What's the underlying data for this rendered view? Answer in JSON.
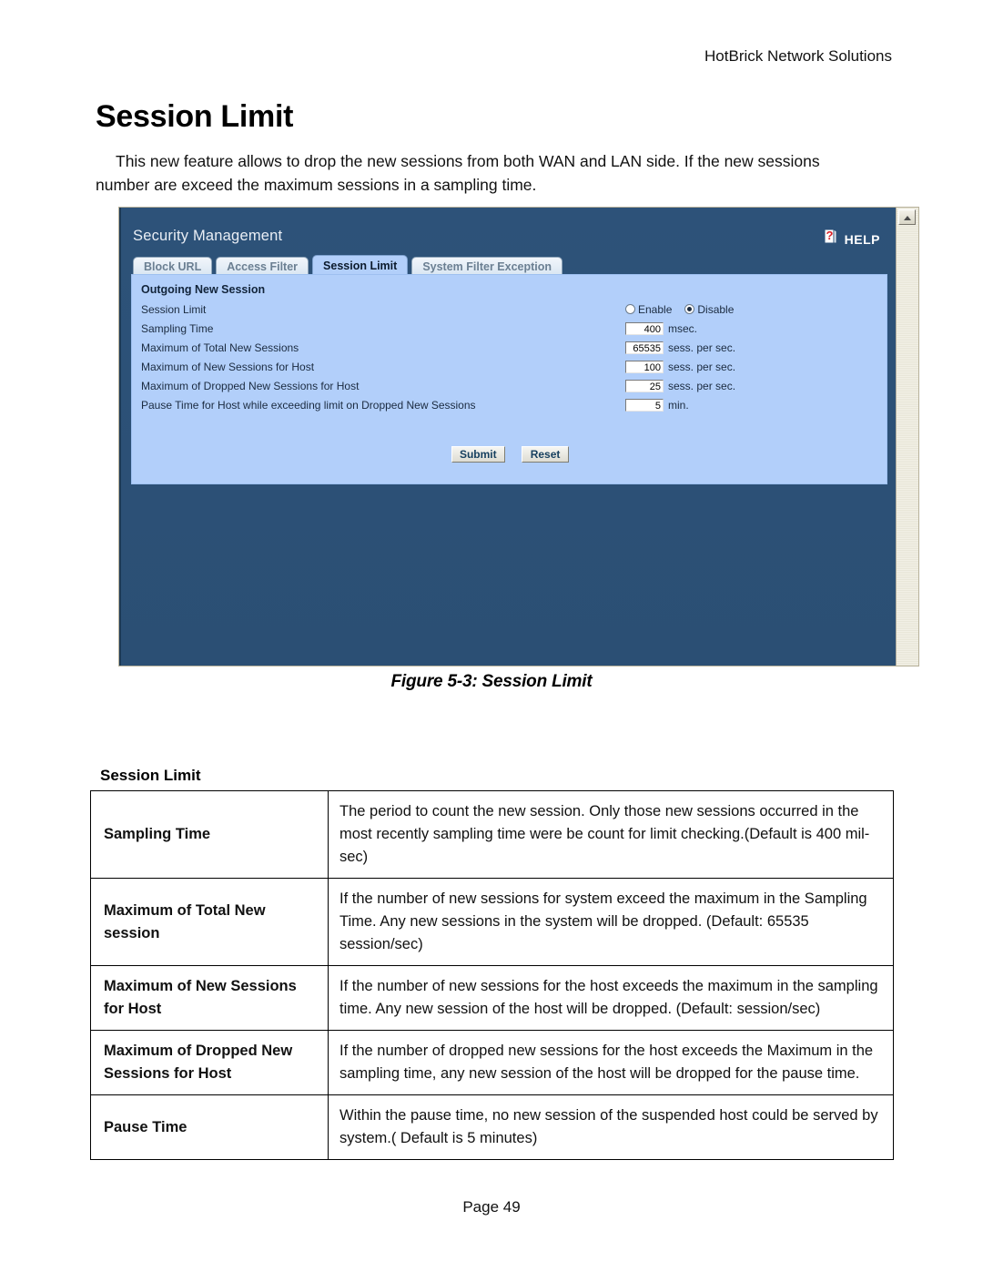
{
  "document": {
    "header_right": "HotBrick Network Solutions",
    "title": "Session Limit",
    "intro": "This new feature allows to drop the new sessions from both WAN and LAN side. If the new sessions number are exceed the maximum sessions in a sampling time.",
    "figure_caption": "Figure 5-3: Session Limit",
    "footer": "Page 49"
  },
  "screenshot": {
    "heading": "Security Management",
    "help_label": "HELP",
    "tabs": [
      {
        "label": "Block URL",
        "active": false
      },
      {
        "label": "Access Filter",
        "active": false
      },
      {
        "label": "Session Limit",
        "active": true
      },
      {
        "label": "System Filter Exception",
        "active": false
      }
    ],
    "panel_title": "Outgoing New Session",
    "fields": [
      {
        "label": "Session Limit",
        "type": "radio",
        "options": [
          "Enable",
          "Disable"
        ],
        "selected": "Disable"
      },
      {
        "label": "Sampling Time",
        "type": "text",
        "value": "400",
        "unit": "msec."
      },
      {
        "label": "Maximum of Total New Sessions",
        "type": "text",
        "value": "65535",
        "unit": "sess. per sec."
      },
      {
        "label": "Maximum of New Sessions for Host",
        "type": "text",
        "value": "100",
        "unit": "sess. per sec."
      },
      {
        "label": "Maximum of Dropped New Sessions for Host",
        "type": "text",
        "value": "25",
        "unit": "sess. per sec."
      },
      {
        "label": "Pause Time for Host while exceeding limit on Dropped New Sessions",
        "type": "text",
        "value": "5",
        "unit": "min."
      }
    ],
    "buttons": {
      "submit": "Submit",
      "reset": "Reset"
    },
    "colors": {
      "chrome_dark_blue": "#2d5279",
      "panel_light_blue": "#b2cffa",
      "help_question_red": "#d81f26",
      "button_text_blue": "#17405f"
    }
  },
  "table": {
    "caption": "Session Limit",
    "rows": [
      {
        "term": "Sampling Time",
        "desc": "The period to count the new session. Only those new sessions occurred in the most recently sampling time were be count for limit checking.(Default is 400 mil-sec)"
      },
      {
        "term": "Maximum of Total New session",
        "desc": "If the number of new sessions for system exceed the maximum in the Sampling Time. Any new sessions in the system will be dropped. (Default: 65535 session/sec)"
      },
      {
        "term": "Maximum of New Sessions for Host",
        "desc": "If the number of new sessions for the host exceeds the maximum in the sampling time. Any new session of the host will be dropped. (Default: session/sec)"
      },
      {
        "term": "Maximum of Dropped New Sessions for Host",
        "desc": "If the number of dropped new sessions for the host exceeds the Maximum in the sampling time, any new session of the host will be dropped for the pause time."
      },
      {
        "term": "Pause Time",
        "desc": "Within the pause time, no new session of the suspended host could be served by system.( Default is 5 minutes)"
      }
    ]
  }
}
